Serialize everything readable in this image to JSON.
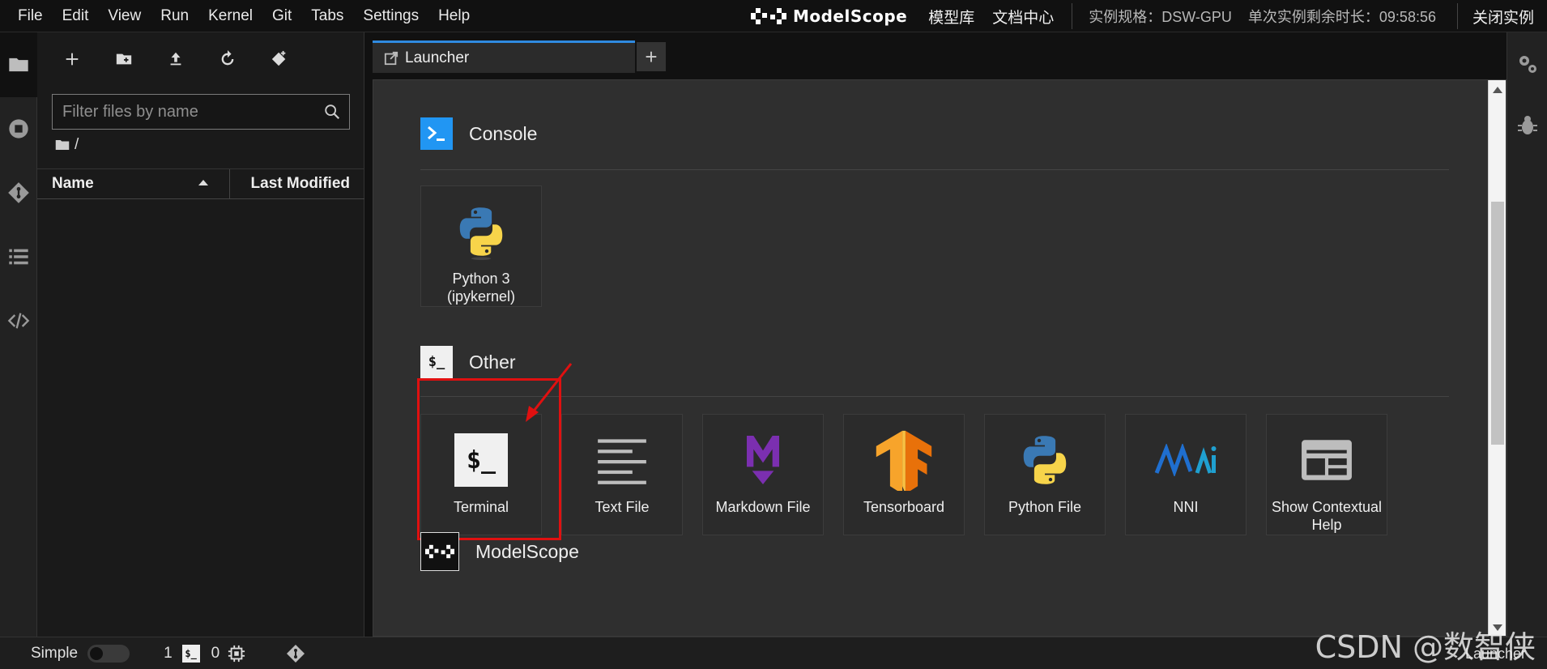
{
  "menu": [
    "File",
    "Edit",
    "View",
    "Run",
    "Kernel",
    "Git",
    "Tabs",
    "Settings",
    "Help"
  ],
  "header": {
    "brand": "ModelScope",
    "links": [
      "模型库",
      "文档中心"
    ],
    "instance_spec": "实例规格：DSW-GPU",
    "remaining_time": "单次实例剩余时长：09:58:56",
    "close_instance": "关闭实例"
  },
  "filebrowser": {
    "filter_placeholder": "Filter files by name",
    "breadcrumb": "/",
    "col_name": "Name",
    "col_modified": "Last Modified"
  },
  "tab": {
    "label": "Launcher",
    "add": "+"
  },
  "launcher": {
    "sections": [
      {
        "title": "Console",
        "items": [
          "Python 3\n(ipykernel)"
        ]
      },
      {
        "title": "Other",
        "items": [
          "Terminal",
          "Text File",
          "Markdown File",
          "Tensorboard",
          "Python File",
          "NNI",
          "Show Contextual Help"
        ]
      },
      {
        "title": "ModelScope",
        "items": []
      }
    ]
  },
  "statusbar": {
    "mode": "Simple",
    "terminals": "1",
    "kernels": "0",
    "right_label": "Launcher"
  },
  "watermark": "CSDN @数智侠",
  "colors": {
    "accent": "#2f8ae0",
    "highlight": "#e01010"
  }
}
